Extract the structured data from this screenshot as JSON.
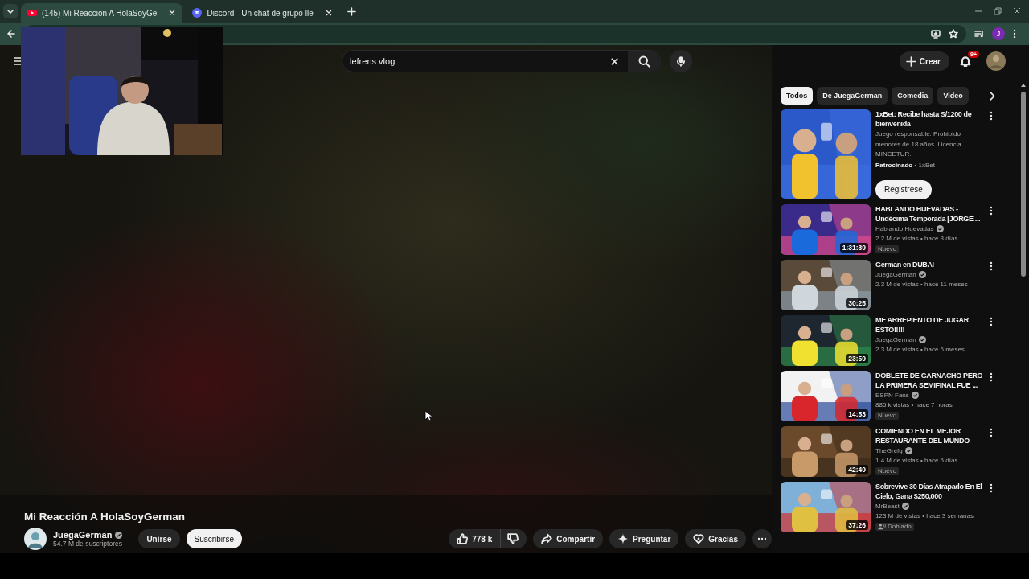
{
  "browser": {
    "tabs": [
      {
        "title": "(145) Mi Reacción A HolaSoyGe",
        "selected": true
      },
      {
        "title": "Discord - Un chat de grupo lle",
        "selected": false
      }
    ],
    "profile_initial": "J"
  },
  "masthead": {
    "search": {
      "value": "lefrens vlog"
    },
    "create_label": "Crear",
    "notifications_badge": "9+"
  },
  "video": {
    "title": "Mi Reacción A HolaSoyGerman",
    "channel": "JuegaGerman",
    "verified": true,
    "subscribers": "54.7 M de suscriptores",
    "join_label": "Unirse",
    "subscribe_label": "Suscribirse",
    "likes": "778 k",
    "actions": [
      {
        "kind": "share",
        "label": "Compartir"
      },
      {
        "kind": "ask",
        "label": "Preguntar"
      },
      {
        "kind": "thanks",
        "label": "Gracias"
      }
    ]
  },
  "chips": [
    {
      "label": "Todos",
      "selected": true
    },
    {
      "label": "De JuegaGerman",
      "selected": false
    },
    {
      "label": "Comedia",
      "selected": false
    },
    {
      "label": "Video",
      "selected": false
    }
  ],
  "ad": {
    "title": "1xBet: Recibe hasta S/1200 de bienvenida",
    "description": "Juego responsable. Prohibido menores de 18 años. Licencia MINCETUR.",
    "sponsor_line": "**Patrocinado** • 1xBet",
    "cta": "Registrese"
  },
  "recommendations": [
    {
      "title": "HABLANDO HUEVADAS - Undécima Temporada [JORGE ...",
      "channel": "Hablando Huevadas",
      "verified": true,
      "meta": "2.2 M de vistas • hace 3 días",
      "duration": "1:31:39",
      "badge": {
        "kind": "new",
        "label": "Nuevo"
      }
    },
    {
      "title": "German en DUBAI",
      "channel": "JuegaGerman",
      "verified": true,
      "meta": "2.3 M de vistas • hace 11 meses",
      "duration": "30:25"
    },
    {
      "title": "ME ARREPIENTO DE JUGAR ESTO!!!!!",
      "channel": "JuegaGerman",
      "verified": true,
      "meta": "2.3 M de vistas • hace 6 meses",
      "duration": "23:59"
    },
    {
      "title": "DOBLETE DE GARNACHO PERO LA PRIMERA SEMIFINAL FUE ...",
      "channel": "ESPN Fans",
      "verified": true,
      "meta": "885 k vistas • hace 7 horas",
      "duration": "14:53",
      "badge": {
        "kind": "new",
        "label": "Nuevo"
      }
    },
    {
      "title": "COMIENDO EN EL MEJOR RESTAURANTE DEL MUNDO",
      "channel": "TheGrefg",
      "verified": true,
      "meta": "1.4 M de vistas • hace 5 días",
      "duration": "42:49",
      "badge": {
        "kind": "new",
        "label": "Nuevo"
      }
    },
    {
      "title": "Sobrevive 30 Días Atrapado En El Cielo, Gana $250,000",
      "channel": "MrBeast",
      "verified": true,
      "meta": "123 M de vistas • hace 3 semanas",
      "duration": "37:26",
      "badge": {
        "kind": "dubbed",
        "label": "Doblado"
      }
    }
  ]
}
